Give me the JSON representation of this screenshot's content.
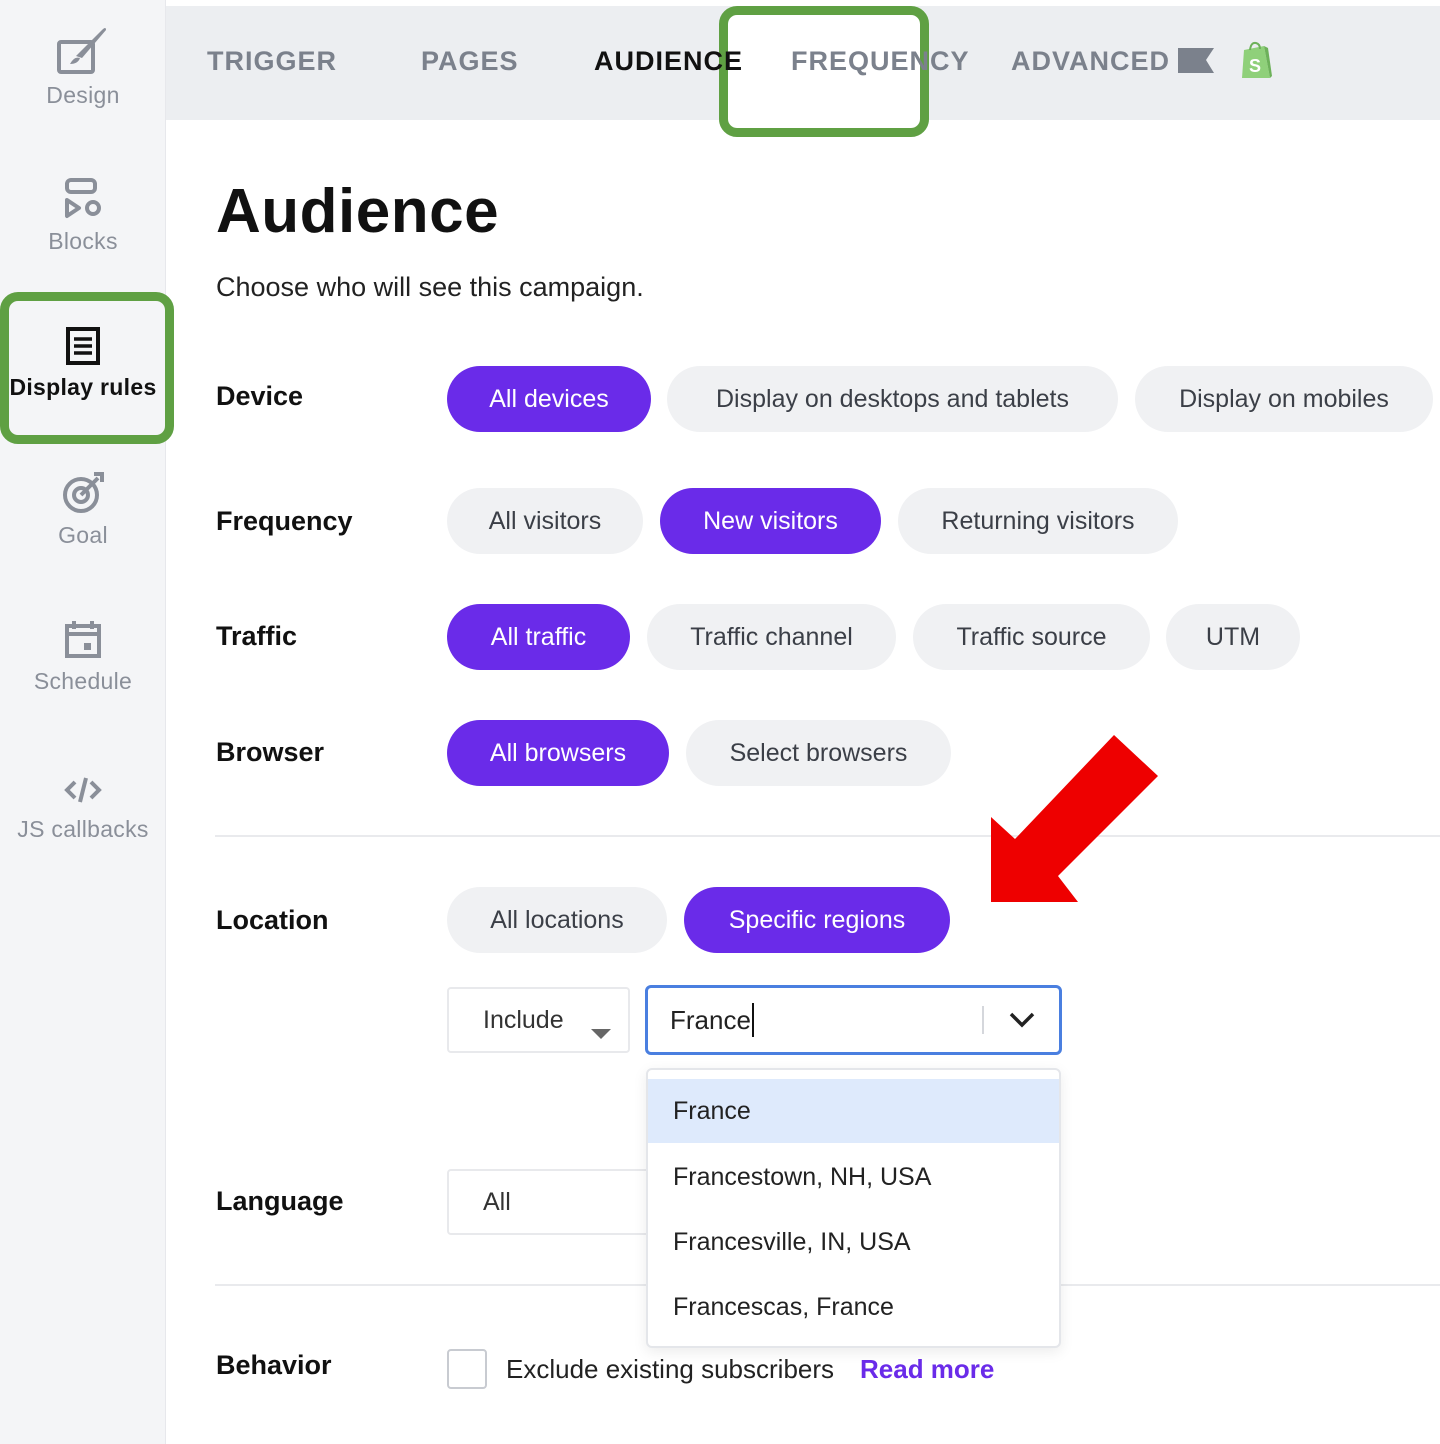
{
  "sidebar": {
    "items": [
      {
        "label": "Design",
        "icon": "design-icon"
      },
      {
        "label": "Blocks",
        "icon": "blocks-icon"
      },
      {
        "label": "Display rules",
        "icon": "display-rules-icon"
      },
      {
        "label": "Goal",
        "icon": "goal-icon"
      },
      {
        "label": "Schedule",
        "icon": "schedule-icon"
      },
      {
        "label": "JS callbacks",
        "icon": "code-icon"
      }
    ],
    "active": "Display rules"
  },
  "tabs": {
    "items": [
      "TRIGGER",
      "PAGES",
      "AUDIENCE",
      "FREQUENCY",
      "ADVANCED"
    ],
    "active": "AUDIENCE"
  },
  "header": {
    "title": "Audience",
    "subtitle": "Choose who will see this campaign."
  },
  "rows": {
    "device": {
      "label": "Device",
      "options": [
        "All devices",
        "Display on desktops and tablets",
        "Display on mobiles"
      ],
      "selected": "All devices"
    },
    "frequency": {
      "label": "Frequency",
      "options": [
        "All visitors",
        "New visitors",
        "Returning visitors"
      ],
      "selected": "New visitors"
    },
    "traffic": {
      "label": "Traffic",
      "options": [
        "All traffic",
        "Traffic channel",
        "Traffic source",
        "UTM"
      ],
      "selected": "All traffic"
    },
    "browser": {
      "label": "Browser",
      "options": [
        "All browsers",
        "Select browsers"
      ],
      "selected": "All browsers"
    },
    "location": {
      "label": "Location",
      "options": [
        "All locations",
        "Specific regions"
      ],
      "selected": "Specific regions",
      "include_select": "Include",
      "search_value": "France",
      "suggestions": [
        "France",
        "Francestown, NH, USA",
        "Francesville, IN, USA",
        "Francescas, France"
      ]
    },
    "language": {
      "label": "Language",
      "select_value": "All"
    },
    "behavior": {
      "label": "Behavior",
      "checkbox_label": "Exclude existing subscribers",
      "checked": false,
      "link": "Read more"
    }
  },
  "colors": {
    "accent": "#6a2be9",
    "highlight_box": "#5fa043",
    "annotation_arrow": "#ee0000",
    "focus": "#4a7fe0"
  }
}
